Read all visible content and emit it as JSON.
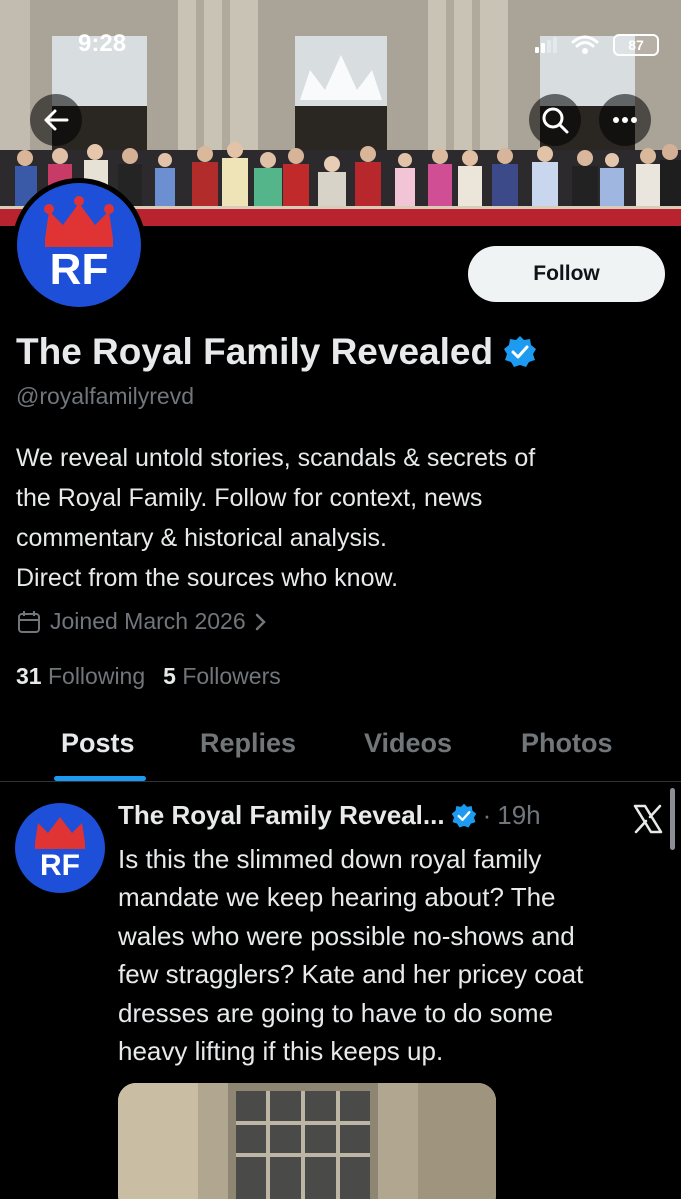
{
  "status_bar": {
    "time": "9:28",
    "battery": "87"
  },
  "profile": {
    "display_name": "The Royal Family Revealed",
    "handle": "@royalfamilyrevd",
    "avatar_text": "RF",
    "follow_label": "Follow",
    "bio_lines": [
      "We reveal untold stories, scandals & secrets of",
      "the Royal Family. Follow for context, news",
      "commentary & historical analysis.",
      "Direct from the sources who know."
    ],
    "joined": "Joined March 2026",
    "following_count": "31",
    "following_label": "Following",
    "followers_count": "5",
    "followers_label": "Followers"
  },
  "tabs": [
    "Posts",
    "Replies",
    "Videos",
    "Photos"
  ],
  "active_tab": "Posts",
  "post": {
    "author": "The Royal Family Reveal...",
    "separator": "·",
    "time": "19h",
    "avatar_text": "RF",
    "text_lines": [
      "Is this the slimmed down royal family",
      "mandate we keep hearing about? The",
      "wales who were possible no-shows and",
      "few stragglers? Kate and her pricey coat",
      "dresses are going to have to do some",
      "heavy lifting if this keeps up."
    ]
  },
  "colors": {
    "accent": "#1d9bf0",
    "background": "#000000",
    "verified": "#1d9bf0",
    "avatar_blue": "#1d4fd8",
    "crown_red": "#e03434"
  },
  "icons": [
    "back-arrow-icon",
    "search-icon",
    "more-icon",
    "verified-badge-icon",
    "calendar-icon",
    "chevron-right-icon",
    "x-logo-icon",
    "signal-icon",
    "wifi-icon",
    "battery-icon"
  ]
}
